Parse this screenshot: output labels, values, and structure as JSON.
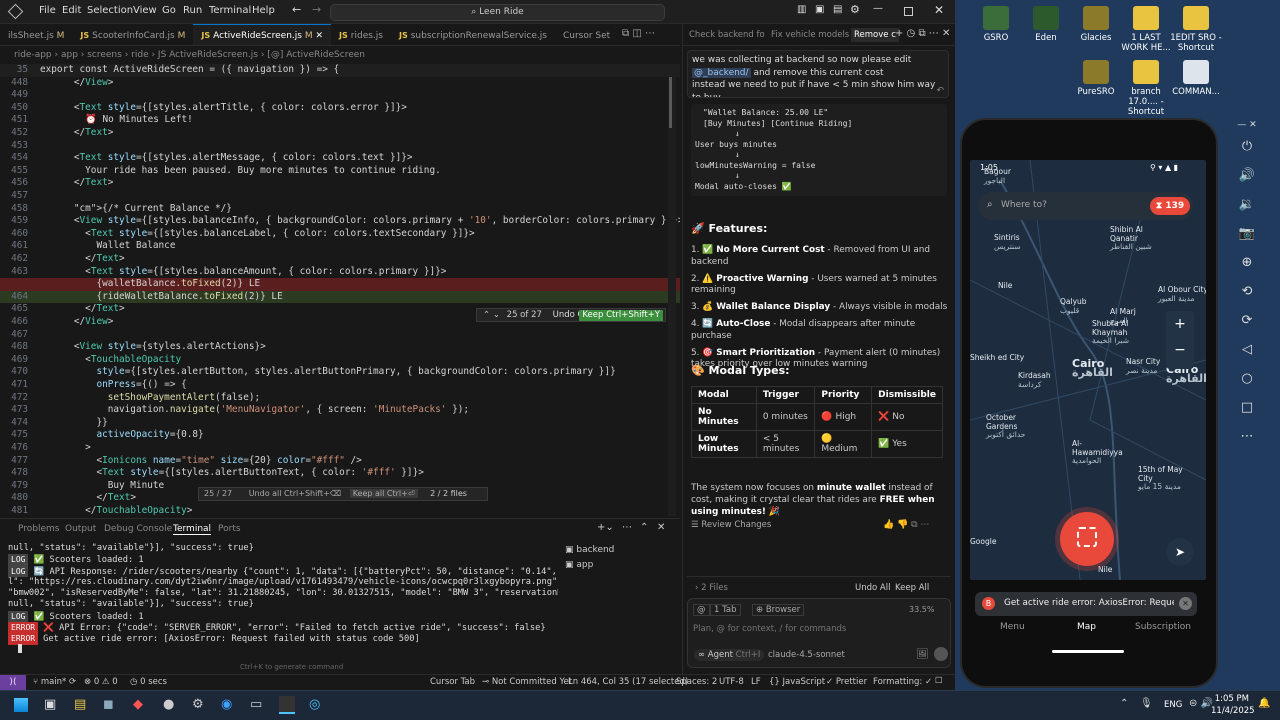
{
  "menubar": {
    "items": [
      "File",
      "Edit",
      "Selection",
      "View",
      "Go",
      "Run",
      "Terminal",
      "Help"
    ],
    "search": "Leen Ride"
  },
  "tabs": [
    {
      "label": "ilsSheet.js",
      "mod": "M"
    },
    {
      "label": "ScooterInfoCard.js",
      "mod": "M"
    },
    {
      "label": "ActiveRideScreen.js",
      "mod": "M",
      "active": true
    },
    {
      "label": "rides.js",
      "mod": ""
    },
    {
      "label": "subscriptionRenewalService.js",
      "mod": ""
    },
    {
      "label": "Cursor Set",
      "mod": ""
    }
  ],
  "breadcrumb": "ride-app › app › screens › ride › JS ActiveRideScreen.js › [@] ActiveRideScreen",
  "sticky": {
    "num": "35",
    "text": "export const ActiveRideScreen = ({ navigation }) => {"
  },
  "code": [
    {
      "n": "448",
      "t": "      </View>"
    },
    {
      "n": "449",
      "t": ""
    },
    {
      "n": "450",
      "t": "      <Text style={[styles.alertTitle, { color: colors.error }]}>"
    },
    {
      "n": "451",
      "t": "        ⏰ No Minutes Left!"
    },
    {
      "n": "452",
      "t": "      </Text>"
    },
    {
      "n": "453",
      "t": ""
    },
    {
      "n": "454",
      "t": "      <Text style={[styles.alertMessage, { color: colors.text }]}>"
    },
    {
      "n": "455",
      "t": "        Your ride has been paused. Buy more minutes to continue riding."
    },
    {
      "n": "456",
      "t": "      </Text>"
    },
    {
      "n": "457",
      "t": ""
    },
    {
      "n": "458",
      "t": "      {/* Current Balance */}"
    },
    {
      "n": "459",
      "t": "      <View style={[styles.balanceInfo, { backgroundColor: colors.primary + '10', borderColor: colors.primary }]}>"
    },
    {
      "n": "460",
      "t": "        <Text style={[styles.balanceLabel, { color: colors.textSecondary }]}>"
    },
    {
      "n": "461",
      "t": "          Wallet Balance"
    },
    {
      "n": "462",
      "t": "        </Text>"
    },
    {
      "n": "463",
      "t": "        <Text style={[styles.balanceAmount, { color: colors.primary }]}>"
    },
    {
      "n": "",
      "t": "          {walletBalance.toFixed(2)} LE",
      "cls": "del"
    },
    {
      "n": "464",
      "t": "          {rideWalletBalance.toFixed(2)} LE",
      "cls": "add"
    },
    {
      "n": "465",
      "t": "        </Text>"
    },
    {
      "n": "466",
      "t": "      </View>"
    },
    {
      "n": "467",
      "t": ""
    },
    {
      "n": "468",
      "t": "      <View style={styles.alertActions}>"
    },
    {
      "n": "469",
      "t": "        <TouchableOpacity"
    },
    {
      "n": "470",
      "t": "          style={[styles.alertButton, styles.alertButtonPrimary, { backgroundColor: colors.primary }]}"
    },
    {
      "n": "471",
      "t": "          onPress={() => {"
    },
    {
      "n": "472",
      "t": "            setShowPaymentAlert(false);"
    },
    {
      "n": "473",
      "t": "            navigation.navigate('MenuNavigator', { screen: 'MinutePacks' });"
    },
    {
      "n": "474",
      "t": "          }}"
    },
    {
      "n": "475",
      "t": "          activeOpacity={0.8}"
    },
    {
      "n": "476",
      "t": "        >"
    },
    {
      "n": "477",
      "t": "          <Ionicons name=\"time\" size={20} color=\"#fff\" />"
    },
    {
      "n": "478",
      "t": "          <Text style={[styles.alertButtonText, { color: '#fff' }]}>"
    },
    {
      "n": "479",
      "t": "            Buy Minute"
    },
    {
      "n": "480",
      "t": "          </Text>"
    },
    {
      "n": "481",
      "t": "        </TouchableOpacity>"
    }
  ],
  "diffbar": {
    "count": "25 of 27",
    "undo": "Undo Ctrl+N",
    "keep": "Keep Ctrl+Shift+Y"
  },
  "diffbar2": {
    "count": "25 / 27",
    "undo": "Undo all Ctrl+Shift+⌫",
    "keep": "Keep all Ctrl+⏎",
    "files": "2 / 2 files"
  },
  "panel": {
    "tabs": [
      "Problems",
      "Output",
      "Debug Console",
      "Terminal",
      "Ports"
    ],
    "sessions": [
      "backend",
      "app"
    ],
    "hint": "Ctrl+K to generate command"
  },
  "terminal": [
    {
      "label": "",
      "text": "null, \"status\": \"available\"}], \"success\": true}"
    },
    {
      "label": "LOG",
      "text": "✅ Scooters loaded: 1"
    },
    {
      "label": "LOG",
      "text": "🔄 API Response: /rider/scooters/nearby {\"count\": 1, \"data\": [{\"batteryPct\": 50, \"distance\": \"0.14\", \"iconUr"
    },
    {
      "label": "",
      "text": "l\": \"https://res.cloudinary.com/dyt2iw6nr/image/upload/v1761493479/vehicle-icons/ocwcpq0r3lxgybopyra.png\", \"id\":"
    },
    {
      "label": "",
      "text": "\"bmw002\", \"isReservedByMe\": false, \"lat\": 31.21880245, \"lon\": 30.01327515, \"model\": \"BMW 3\", \"reservationRideId\":"
    },
    {
      "label": "",
      "text": "null, \"status\": \"available\"}], \"success\": true}"
    },
    {
      "label": "LOG",
      "text": "✅ Scooters loaded: 1"
    },
    {
      "label": "ERROR",
      "text": "❌ API Error: {\"code\": \"SERVER_ERROR\", \"error\": \"Failed to fetch active ride\", \"success\": false}"
    },
    {
      "label": "ERROR",
      "text": "Get active ride error: [AxiosError: Request failed with status code 500]"
    }
  ],
  "statusbar": {
    "branch": "main*",
    "sync": "⟳",
    "errors": "⊗ 0 ⚠ 0",
    "time": "◷ 0 secs",
    "tab": "Cursor Tab",
    "commit": "Not Committed Yet",
    "pos": "Ln 464, Col 35 (17 selected)",
    "spaces": "Spaces: 2",
    "enc": "UTF-8",
    "eol": "LF",
    "lang": "{} JavaScript",
    "prettier": "✓ Prettier",
    "fmt": "Formatting: ✓"
  },
  "chat": {
    "tabs": [
      "Check backend fo",
      "Fix vehicle models",
      "Remove c"
    ],
    "user": "we was collecting at backend so now please edit",
    "mention": "@_backend/",
    "user2": "and remove this current cost",
    "user3": "instead we need to put if have < 5 min show him way to buy",
    "flow": [
      "\"Wallet Balance: 25.00 LE\"",
      "[Buy Minutes] [Continue Riding]",
      "↓",
      "User buys minutes",
      "↓",
      "lowMinutesWarning = false",
      "↓",
      "Modal auto-closes ✅"
    ],
    "features_title": "🚀 Features:",
    "features": [
      {
        "n": "1.",
        "icon": "✅",
        "b": "No More Current Cost",
        "t": " - Removed from UI and backend"
      },
      {
        "n": "2.",
        "icon": "⚠️",
        "b": "Proactive Warning",
        "t": " - Users warned at 5 minutes remaining"
      },
      {
        "n": "3.",
        "icon": "💰",
        "b": "Wallet Balance Display",
        "t": " - Always visible in modals"
      },
      {
        "n": "4.",
        "icon": "🔄",
        "b": "Auto-Close",
        "t": " - Modal disappears after minute purchase"
      },
      {
        "n": "5.",
        "icon": "🎯",
        "b": "Smart Prioritization",
        "t": " - Payment alert (0 minutes) takes priority over low minutes warning"
      }
    ],
    "modal_title": "🎨 Modal Types:",
    "table_head": [
      "Modal",
      "Trigger",
      "Priority",
      "Dismissible"
    ],
    "table_rows": [
      [
        "No Minutes",
        "0 minutes",
        "🔴 High",
        "❌ No"
      ],
      [
        "Low Minutes",
        "< 5 minutes",
        "🟡 Medium",
        "✅ Yes"
      ]
    ],
    "summary1": "The system now focuses on ",
    "summary_b": "minute wallet",
    "summary2": " instead of cost, making it crystal clear that rides are ",
    "summary_b2": "FREE when using minutes!",
    "summary3": " 🎉",
    "review": "Review Changes",
    "files": "2 Files",
    "undo_all": "Undo All",
    "keep_all": "Keep All",
    "input_at": "@",
    "input_tab": "1 Tab",
    "input_browser": "Browser",
    "input_pct": "33.5%",
    "placeholder": "Plan, @ for context, / for commands",
    "agent": "Agent",
    "agent_key": "Ctrl+I",
    "model": "claude-4.5-sonnet"
  },
  "desktop": [
    {
      "label": "GSRO",
      "color": "#3a6d3a"
    },
    {
      "label": "Eden",
      "color": "#2d5a2d"
    },
    {
      "label": "Glacies",
      "color": "#8a7a2a"
    },
    {
      "label": "1 LAST WORK HE...",
      "color": "#e8c440"
    },
    {
      "label": "1EDIT SRO - Shortcut",
      "color": "#e8c440"
    },
    {
      "label": "PureSRO",
      "color": "#8a7a2a"
    },
    {
      "label": "branch 17.0.... - Shortcut",
      "color": "#e8c440"
    },
    {
      "label": "COMMAN...",
      "color": "#dde4ec"
    }
  ],
  "phone": {
    "status_time": "1:05",
    "search": "Where to?",
    "badge": "139",
    "places": [
      {
        "t": "Bagour",
        "ar": "الباجور"
      },
      {
        "t": "Shibin Al Qanatir",
        "ar": "شبين القناطر"
      },
      {
        "t": "Sintiris",
        "ar": "سنتريس"
      },
      {
        "t": "Nile",
        "ar": ""
      },
      {
        "t": "Al Obour City",
        "ar": "مدينة العبور"
      },
      {
        "t": "Qalyub",
        "ar": "قليوب"
      },
      {
        "t": "Al Marj",
        "ar": "المرج"
      },
      {
        "t": "Shubra Al Khaymah",
        "ar": "شبرا الخيمة"
      },
      {
        "t": "Sheikh ed City",
        "ar": ""
      },
      {
        "t": "Cairo",
        "ar": "القاهرة"
      },
      {
        "t": "Nasr City",
        "ar": "مدينة نصر"
      },
      {
        "t": "Kirdasah",
        "ar": "كرداسة"
      },
      {
        "t": "Cairo",
        "ar": "القاهرة"
      },
      {
        "t": "October Gardens",
        "ar": "حدائق أكتوبر"
      },
      {
        "t": "Al-Hawamidiyya",
        "ar": "الحوامدية"
      },
      {
        "t": "15th of May City",
        "ar": "مدينة 15 مايو"
      },
      {
        "t": "Google",
        "ar": ""
      },
      {
        "t": "Nile",
        "ar": ""
      }
    ],
    "toast": "Get active ride error: AxiosError: Request fai...",
    "nav": [
      "Menu",
      "Map",
      "Subscription"
    ]
  },
  "taskbar": {
    "lang": "ENG",
    "time": "1:05 PM",
    "date": "11/4/2025"
  },
  "colors": {
    "accent": "#0078d4",
    "error": "#f14c4c",
    "keep": "#3c8f3c",
    "phone_red": "#e8493a"
  }
}
